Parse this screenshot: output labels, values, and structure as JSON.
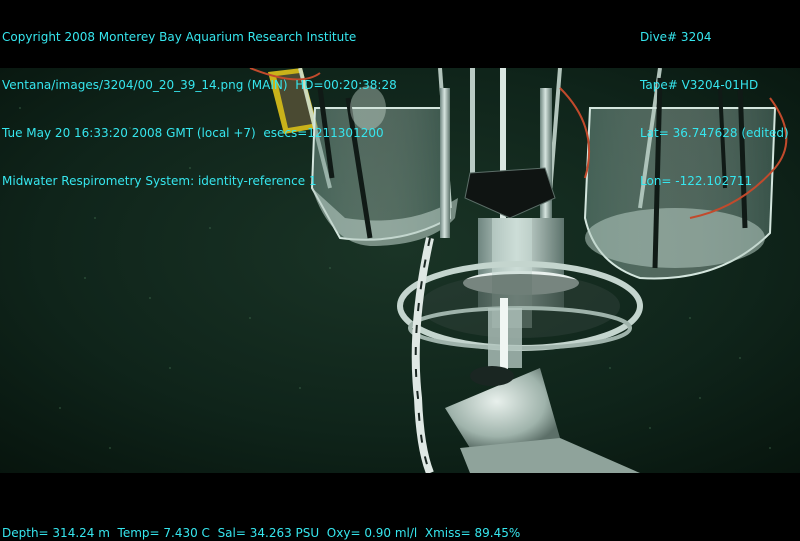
{
  "overlay": {
    "left_lines": [
      "Copyright 2008 Monterey Bay Aquarium Research Institute",
      "Ventana/images/3204/00_20_39_14.png (MAIN)  HD=00:20:38:28",
      "Tue May 20 16:33:20 2008 GMT (local +7)  esecs=1211301200",
      "Midwater Respirometry System: identity-reference 1"
    ],
    "right_lines": [
      "Dive# 3204",
      "Tape# V3204-01HD",
      "Lat= 36.747628 (edited)",
      "Lon= -122.102711"
    ],
    "bottom_line": "Depth= 314.24 m  Temp= 7.430 C  Sal= 34.263 PSU  Oxy= 0.90 ml/l  Xmiss= 89.45%"
  },
  "colors": {
    "overlay_text": "#36e6ee",
    "water": "#0e1f18",
    "background": "#000000"
  }
}
